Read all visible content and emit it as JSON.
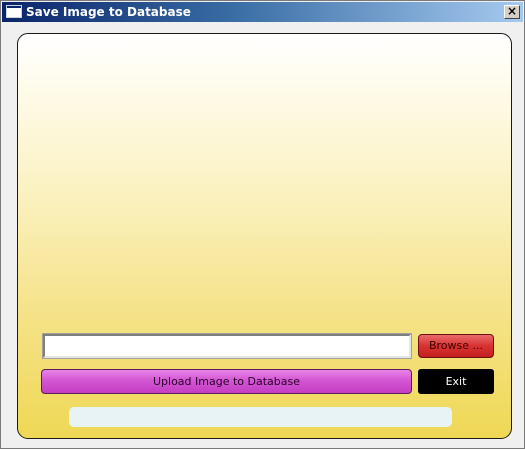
{
  "window": {
    "title": "Save Image to Database",
    "close_glyph": "×",
    "title_icon": "window-icon",
    "close_icon": "close-icon"
  },
  "form": {
    "path_value": "",
    "path_placeholder": "",
    "browse_label": "Browse ...",
    "upload_label": "Upload Image to Database",
    "exit_label": "Exit"
  },
  "progress": {
    "value_fraction": 0
  },
  "colors": {
    "titlebar_start": "#0a246a",
    "titlebar_end": "#a6caf0",
    "panel_top": "#ffffff",
    "panel_bottom": "#efd855",
    "browse_button": "#d83232",
    "upload_button": "#d356d3",
    "exit_button": "#000000",
    "progress_track": "#e8f3f5"
  }
}
